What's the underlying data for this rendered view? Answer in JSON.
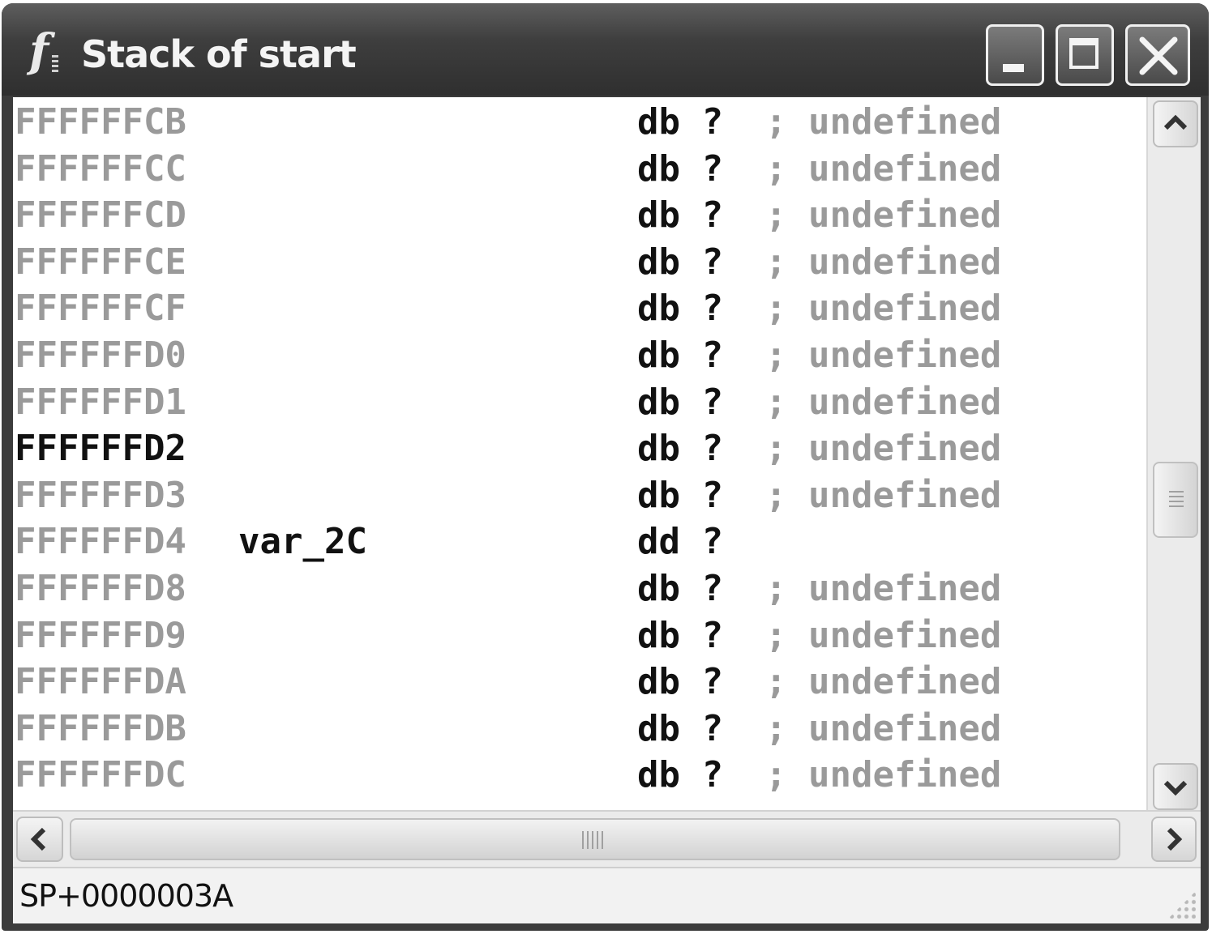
{
  "window": {
    "title": "Stack of start",
    "app_icon": "ida-function-icon",
    "controls": [
      "minimize-icon",
      "maximize-icon",
      "close-icon"
    ]
  },
  "listing": {
    "rows": [
      {
        "address": "FFFFFFCB",
        "name": "",
        "instr": "db ?",
        "comment": "; undefined",
        "current": false
      },
      {
        "address": "FFFFFFCC",
        "name": "",
        "instr": "db ?",
        "comment": "; undefined",
        "current": false
      },
      {
        "address": "FFFFFFCD",
        "name": "",
        "instr": "db ?",
        "comment": "; undefined",
        "current": false
      },
      {
        "address": "FFFFFFCE",
        "name": "",
        "instr": "db ?",
        "comment": "; undefined",
        "current": false
      },
      {
        "address": "FFFFFFCF",
        "name": "",
        "instr": "db ?",
        "comment": "; undefined",
        "current": false
      },
      {
        "address": "FFFFFFD0",
        "name": "",
        "instr": "db ?",
        "comment": "; undefined",
        "current": false
      },
      {
        "address": "FFFFFFD1",
        "name": "",
        "instr": "db ?",
        "comment": "; undefined",
        "current": false
      },
      {
        "address": "FFFFFFD2",
        "name": "",
        "instr": "db ?",
        "comment": "; undefined",
        "current": true
      },
      {
        "address": "FFFFFFD3",
        "name": "",
        "instr": "db ?",
        "comment": "; undefined",
        "current": false
      },
      {
        "address": "FFFFFFD4",
        "name": "var_2C",
        "instr": "dd ?",
        "comment": "",
        "current": false
      },
      {
        "address": "FFFFFFD8",
        "name": "",
        "instr": "db ?",
        "comment": "; undefined",
        "current": false
      },
      {
        "address": "FFFFFFD9",
        "name": "",
        "instr": "db ?",
        "comment": "; undefined",
        "current": false
      },
      {
        "address": "FFFFFFDA",
        "name": "",
        "instr": "db ?",
        "comment": "; undefined",
        "current": false
      },
      {
        "address": "FFFFFFDB",
        "name": "",
        "instr": "db ?",
        "comment": "; undefined",
        "current": false
      },
      {
        "address": "FFFFFFDC",
        "name": "",
        "instr": "db ?",
        "comment": "; undefined",
        "current": false
      }
    ]
  },
  "status": {
    "text": "SP+0000003A"
  },
  "colors": {
    "title_bar": "#3e3e3e",
    "address_text": "#9a9a9a",
    "code_text": "#111111",
    "background": "#ffffff"
  }
}
